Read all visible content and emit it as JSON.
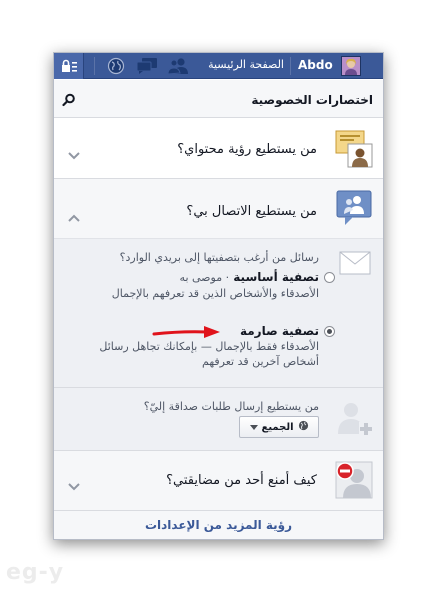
{
  "topbar": {
    "home_label": "الصفحة الرئيسية",
    "user_name": "Abdo",
    "icons": [
      "privacy-lock-icon",
      "globe-icon",
      "messages-icon",
      "friends-icon"
    ]
  },
  "header": {
    "title": "اختصارات الخصوصية",
    "search_icon": "search-icon"
  },
  "sections": {
    "who_can_see": {
      "title": "من يستطيع رؤية محتواي؟",
      "icon": "content-icon"
    },
    "who_can_contact": {
      "title": "من يستطيع الاتصال بي؟",
      "icon": "contact-icon",
      "inbox_question": "رسائل من أرغب بتصفيتها إلى بريدي الوارد؟",
      "options": [
        {
          "title": "تصفية أساسية",
          "note": "· موصى به",
          "description": "الأصدقاء والأشخاص الذين قد تعرفهم بالإجمال",
          "selected": false
        },
        {
          "title": "تصفية صارمة",
          "description": "الأصدقاء فقط بالإجمال — بإمكانك تجاهل رسائل أشخاص آخرين قد تعرفهم",
          "selected": true
        }
      ],
      "friend_requests_question": "من يستطيع إرسال طلبات صداقة إليّ؟",
      "friend_requests_value": "الجميع"
    },
    "block": {
      "title": "كيف أمنع أحد من مضايقتي؟",
      "icon": "block-icon"
    }
  },
  "footer": {
    "link": "رؤية المزيد من الإعدادات"
  },
  "watermark": "eg-y",
  "colors": {
    "brand": "#3b5998",
    "arrow": "#e0131b"
  }
}
